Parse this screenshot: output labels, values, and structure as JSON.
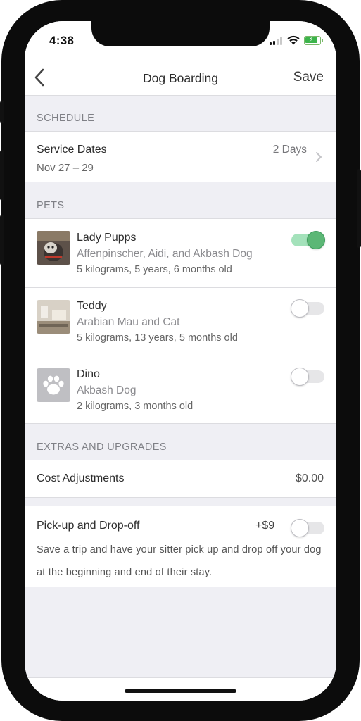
{
  "status_bar": {
    "time": "4:38"
  },
  "nav": {
    "back_icon": "chevron-left-icon",
    "title": "Dog Boarding",
    "save_label": "Save"
  },
  "schedule": {
    "header": "SCHEDULE",
    "service_dates_label": "Service Dates",
    "service_dates_value": "Nov 27 – 29",
    "duration": "2 Days"
  },
  "pets": {
    "header": "PETS",
    "items": [
      {
        "name": "Lady Pupps",
        "breed": "Affenpinscher, Aidi, and Akbash Dog",
        "details": "5 kilograms, 5 years, 6 months old",
        "selected": true
      },
      {
        "name": "Teddy",
        "breed": "Arabian Mau and Cat",
        "details": "5 kilograms, 13 years, 5 months old",
        "selected": false
      },
      {
        "name": "Dino",
        "breed": "Akbash Dog",
        "details": "2 kilograms, 3 months old",
        "selected": false,
        "avatar_icon": "paw-icon"
      }
    ]
  },
  "extras": {
    "header": "EXTRAS AND UPGRADES",
    "cost_adjustments_label": "Cost Adjustments",
    "cost_adjustments_value": "$0.00",
    "pickup_label": "Pick-up and Drop-off",
    "pickup_price": "+$9",
    "pickup_enabled": false,
    "pickup_description": "Save a trip and have your sitter pick up and drop off your dog at the beginning and end of their stay."
  },
  "colors": {
    "toggle_on": "#5cb776",
    "background": "#efeff4"
  }
}
